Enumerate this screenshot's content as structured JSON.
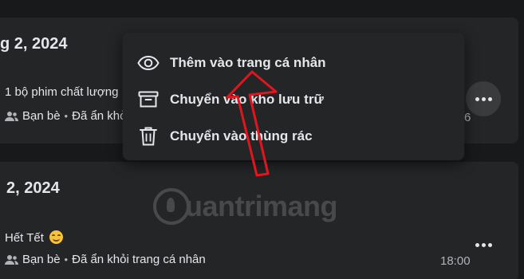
{
  "posts": [
    {
      "date": "g 2, 2024",
      "text": "1 bộ phim chất lượng",
      "audience": "Bạn bè",
      "status": "Đã ẩn khỏ",
      "time": "6"
    },
    {
      "date": "2, 2024",
      "text": "Hết Tết",
      "audience": "Bạn bè",
      "status": "Đã ẩn khỏi trang cá nhân",
      "time": "18:00"
    }
  ],
  "menu": {
    "items": [
      {
        "label": "Thêm vào trang cá nhân",
        "icon": "eye-icon"
      },
      {
        "label": "Chuyển vào kho lưu trữ",
        "icon": "archive-icon"
      },
      {
        "label": "Chuyển vào thùng rác",
        "icon": "trash-icon"
      }
    ]
  },
  "watermark": {
    "text": "uantrimang"
  },
  "colors": {
    "page_bg": "#18191a",
    "card_bg": "#242526",
    "text_primary": "#e4e6eb",
    "text_secondary": "#b0b3b8",
    "annotation_arrow": "#e0161f"
  }
}
